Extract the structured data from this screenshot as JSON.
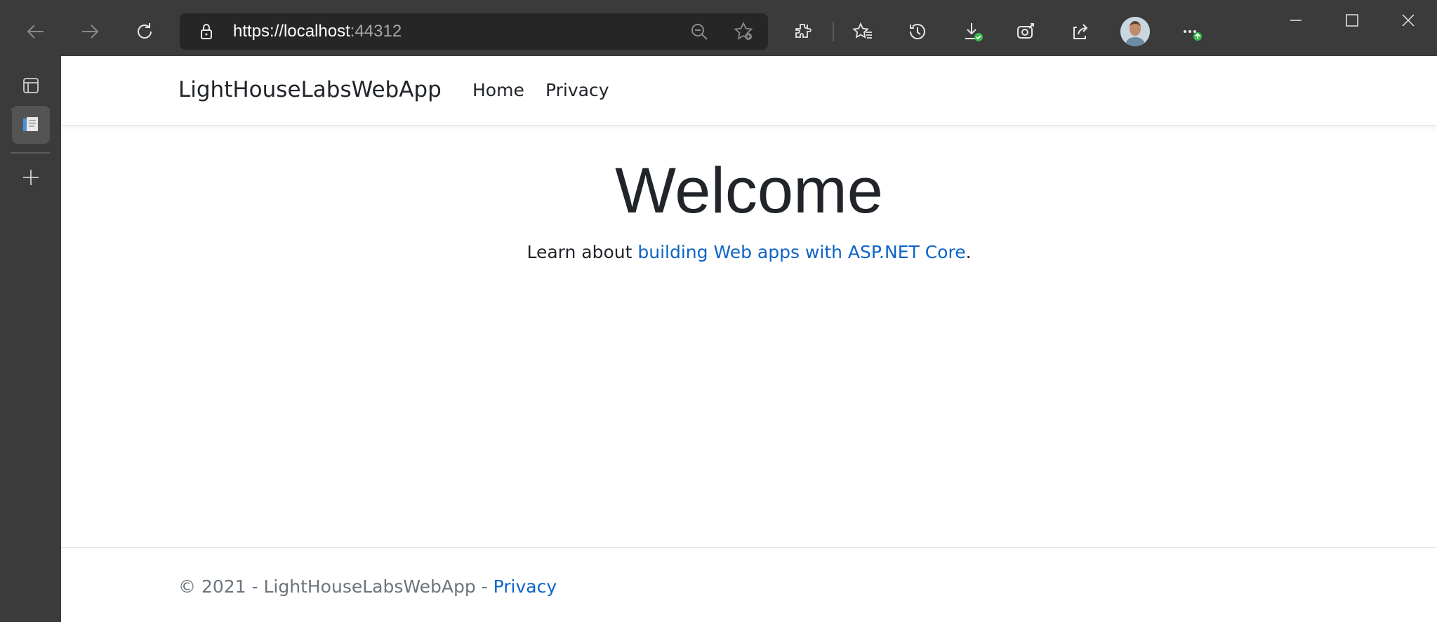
{
  "browser": {
    "url_scheme": "https://",
    "url_host": "localhost",
    "url_port": ":44312",
    "icons": [
      "back-icon",
      "forward-icon",
      "refresh-icon",
      "lock-icon",
      "zoom-out-icon",
      "add-favorite-icon",
      "extensions-icon",
      "favorites-icon",
      "history-icon",
      "downloads-icon",
      "web-capture-icon",
      "share-icon",
      "profile-avatar",
      "more-icon"
    ]
  },
  "window": {
    "controls": [
      "minimize-icon",
      "maximize-icon",
      "close-icon"
    ]
  },
  "tab_strip": {
    "icons": [
      "tab-actions-icon",
      "page-tab-icon",
      "new-tab-icon"
    ]
  },
  "site": {
    "brand": "LightHouseLabsWebApp",
    "nav": {
      "home": "Home",
      "privacy": "Privacy"
    },
    "heading": "Welcome",
    "learn_prefix": "Learn about ",
    "learn_link": "building Web apps with ASP.NET Core",
    "learn_suffix": ".",
    "footer_text": "© 2021 - LightHouseLabsWebApp - ",
    "footer_link": "Privacy"
  },
  "colors": {
    "chrome_bg": "#3b3b3b",
    "address_bg": "#262626",
    "link": "#0d63c8",
    "text": "#212529",
    "muted": "#6c757d",
    "accent_green": "#3fb950"
  }
}
